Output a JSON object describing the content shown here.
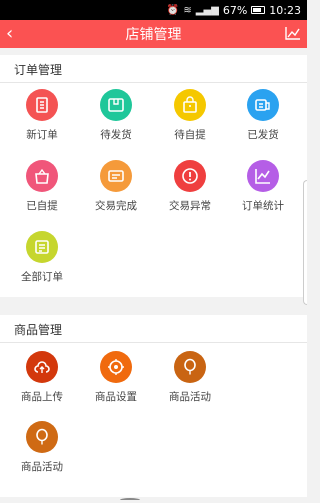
{
  "status_bar": {
    "battery": "67%",
    "time": "10:23"
  },
  "header": {
    "title": "店铺管理",
    "back_icon": "back-arrow-icon",
    "right_icon": "line-chart-icon"
  },
  "order_section": {
    "title": "订单管理",
    "items": [
      {
        "label": "新订单",
        "icon": "document-icon",
        "color": "#f45353"
      },
      {
        "label": "待发货",
        "icon": "box-icon",
        "color": "#1fc79a"
      },
      {
        "label": "待自提",
        "icon": "bag-icon",
        "color": "#f5c800"
      },
      {
        "label": "已发货",
        "icon": "truck-icon",
        "color": "#2aa2f0"
      },
      {
        "label": "已自提",
        "icon": "shopping-bag-icon",
        "color": "#f0567a"
      },
      {
        "label": "交易完成",
        "icon": "card-icon",
        "color": "#f59a3a"
      },
      {
        "label": "交易异常",
        "icon": "exclamation-icon",
        "color": "#ef3f3f"
      },
      {
        "label": "订单统计",
        "icon": "chart-icon",
        "color": "#b55ee6"
      },
      {
        "label": "全部订单",
        "icon": "list-icon",
        "color": "#c6d62e"
      }
    ]
  },
  "goods_section": {
    "title": "商品管理",
    "items": [
      {
        "label": "商品上传",
        "icon": "cloud-upload-icon",
        "color": "#d3380c"
      },
      {
        "label": "商品设置",
        "icon": "settings-icon",
        "color": "#f06a0e"
      },
      {
        "label": "商品活动",
        "icon": "balloon-icon",
        "color": "#c96412"
      },
      {
        "label": "商品活动",
        "icon": "balloon-icon",
        "color": "#cf6a14"
      }
    ]
  }
}
